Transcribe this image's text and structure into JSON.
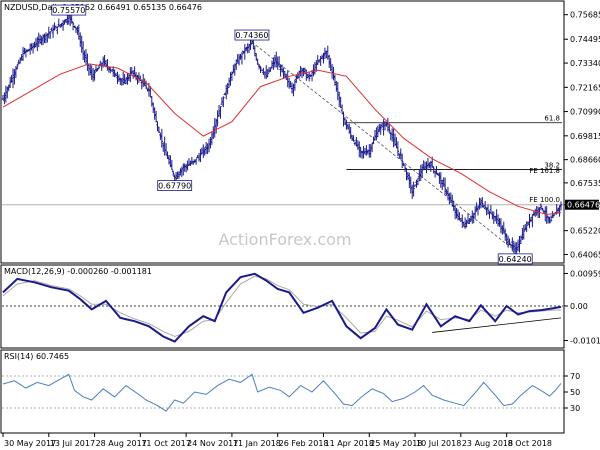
{
  "header": {
    "symbol": "NZDUSD,Daily",
    "ohlc": "0.65162 0.66491 0.65135 0.66476"
  },
  "watermark": "ActionForex.com",
  "chart_data": [
    {
      "type": "candlestick",
      "title": "NZDUSD,Daily 0.65162 0.66491 0.65135 0.66476",
      "ylim": [
        0.637,
        0.763
      ],
      "y_ticks": [
        "0.75685",
        "0.74495",
        "0.73340",
        "0.72165",
        "0.70990",
        "0.69815",
        "0.68660",
        "0.67535",
        "0.66476",
        "0.65220",
        "0.64065"
      ],
      "y_tick_values": [
        0.75685,
        0.74495,
        0.7334,
        0.72165,
        0.7099,
        0.69815,
        0.6866,
        0.67535,
        0.66476,
        0.6522,
        0.64065
      ],
      "last_price": 0.66476,
      "price_keypoints": [
        [
          0,
          0.716
        ],
        [
          6,
          0.726
        ],
        [
          14,
          0.738
        ],
        [
          20,
          0.741
        ],
        [
          28,
          0.746
        ],
        [
          34,
          0.749
        ],
        [
          40,
          0.752
        ],
        [
          46,
          0.7557
        ],
        [
          52,
          0.749
        ],
        [
          56,
          0.738
        ],
        [
          62,
          0.727
        ],
        [
          70,
          0.734
        ],
        [
          78,
          0.728
        ],
        [
          84,
          0.724
        ],
        [
          90,
          0.729
        ],
        [
          96,
          0.725
        ],
        [
          102,
          0.72
        ],
        [
          108,
          0.702
        ],
        [
          114,
          0.689
        ],
        [
          120,
          0.6779
        ],
        [
          126,
          0.683
        ],
        [
          132,
          0.685
        ],
        [
          138,
          0.689
        ],
        [
          144,
          0.694
        ],
        [
          150,
          0.708
        ],
        [
          156,
          0.721
        ],
        [
          162,
          0.732
        ],
        [
          168,
          0.739
        ],
        [
          174,
          0.743
        ],
        [
          178,
          0.733
        ],
        [
          184,
          0.727
        ],
        [
          190,
          0.735
        ],
        [
          196,
          0.728
        ],
        [
          202,
          0.721
        ],
        [
          208,
          0.731
        ],
        [
          214,
          0.726
        ],
        [
          220,
          0.734
        ],
        [
          226,
          0.739
        ],
        [
          232,
          0.724
        ],
        [
          238,
          0.706
        ],
        [
          244,
          0.697
        ],
        [
          250,
          0.69
        ],
        [
          256,
          0.691
        ],
        [
          262,
          0.701
        ],
        [
          268,
          0.704
        ],
        [
          274,
          0.694
        ],
        [
          280,
          0.684
        ],
        [
          286,
          0.671
        ],
        [
          292,
          0.681
        ],
        [
          298,
          0.685
        ],
        [
          304,
          0.679
        ],
        [
          310,
          0.671
        ],
        [
          316,
          0.661
        ],
        [
          322,
          0.655
        ],
        [
          328,
          0.659
        ],
        [
          334,
          0.666
        ],
        [
          340,
          0.661
        ],
        [
          346,
          0.657
        ],
        [
          352,
          0.648
        ],
        [
          358,
          0.6424
        ],
        [
          364,
          0.652
        ],
        [
          370,
          0.66
        ],
        [
          376,
          0.664
        ],
        [
          382,
          0.656
        ],
        [
          386,
          0.661
        ],
        [
          390,
          0.6648
        ]
      ],
      "moving_average": [
        [
          0,
          0.712
        ],
        [
          20,
          0.72
        ],
        [
          40,
          0.728
        ],
        [
          60,
          0.733
        ],
        [
          80,
          0.731
        ],
        [
          100,
          0.724
        ],
        [
          120,
          0.709
        ],
        [
          140,
          0.698
        ],
        [
          160,
          0.705
        ],
        [
          180,
          0.722
        ],
        [
          200,
          0.727
        ],
        [
          220,
          0.73
        ],
        [
          240,
          0.727
        ],
        [
          260,
          0.711
        ],
        [
          280,
          0.697
        ],
        [
          300,
          0.687
        ],
        [
          320,
          0.68
        ],
        [
          340,
          0.671
        ],
        [
          360,
          0.664
        ],
        [
          380,
          0.66
        ],
        [
          390,
          0.661
        ]
      ],
      "annotations": [
        {
          "text": "0.75570",
          "index": 46,
          "price": 0.7557,
          "position": "above"
        },
        {
          "text": "0.74360",
          "index": 174,
          "price": 0.7436,
          "position": "above"
        },
        {
          "text": "0.67790",
          "index": 120,
          "price": 0.6779,
          "position": "below"
        },
        {
          "text": "0.64240",
          "index": 358,
          "price": 0.6424,
          "position": "below"
        }
      ],
      "fibonacci": [
        {
          "label": "61.8",
          "price": 0.7045,
          "from_index": 240
        },
        {
          "label": "38.2",
          "price": 0.6818,
          "from_index": 240
        },
        {
          "label": "FE 161.8",
          "price": 0.6791,
          "from_index": null
        },
        {
          "label": "FE 100.0",
          "price": 0.665,
          "from_index": null
        }
      ],
      "dashed_trendline": [
        [
          174,
          0.7436
        ],
        [
          358,
          0.6424
        ]
      ]
    },
    {
      "type": "line",
      "title": "MACD(12,26,9) -0.000260 -0.001181",
      "ylim": [
        -0.0118,
        0.0115
      ],
      "y_ticks": [
        "0.009597",
        "0.00",
        "-0.01018"
      ],
      "y_tick_values": [
        0.009597,
        0.0,
        -0.01018
      ],
      "series": [
        {
          "name": "MACD",
          "color": "#1a1a8c",
          "points": [
            [
              0,
              0.004
            ],
            [
              10,
              0.008
            ],
            [
              22,
              0.007
            ],
            [
              34,
              0.0055
            ],
            [
              46,
              0.0045
            ],
            [
              54,
              0.002
            ],
            [
              62,
              -0.001
            ],
            [
              72,
              0.0015
            ],
            [
              82,
              -0.0035
            ],
            [
              92,
              -0.0045
            ],
            [
              102,
              -0.006
            ],
            [
              112,
              -0.009
            ],
            [
              120,
              -0.0105
            ],
            [
              130,
              -0.006
            ],
            [
              140,
              -0.003
            ],
            [
              148,
              -0.0045
            ],
            [
              156,
              0.004
            ],
            [
              166,
              0.0085
            ],
            [
              176,
              0.0095
            ],
            [
              184,
              0.0075
            ],
            [
              192,
              0.005
            ],
            [
              200,
              0.004
            ],
            [
              210,
              -0.002
            ],
            [
              220,
              -0.0005
            ],
            [
              230,
              0.0015
            ],
            [
              240,
              -0.006
            ],
            [
              250,
              -0.0095
            ],
            [
              260,
              -0.0065
            ],
            [
              268,
              -0.001
            ],
            [
              276,
              -0.0055
            ],
            [
              286,
              -0.007
            ],
            [
              296,
              0.0005
            ],
            [
              306,
              -0.006
            ],
            [
              316,
              -0.003
            ],
            [
              326,
              -0.0045
            ],
            [
              334,
              0.0002
            ],
            [
              344,
              -0.0045
            ],
            [
              352,
              0.0
            ],
            [
              360,
              -0.0025
            ],
            [
              368,
              -0.0015
            ],
            [
              376,
              -0.0012
            ],
            [
              384,
              -0.0007
            ],
            [
              390,
              -0.00026
            ]
          ]
        },
        {
          "name": "Signal",
          "color": "#aaaaaa",
          "points": [
            [
              0,
              0.003
            ],
            [
              10,
              0.0065
            ],
            [
              22,
              0.0075
            ],
            [
              34,
              0.006
            ],
            [
              46,
              0.005
            ],
            [
              54,
              0.003
            ],
            [
              62,
              0.0005
            ],
            [
              72,
              0.0005
            ],
            [
              82,
              -0.002
            ],
            [
              92,
              -0.0038
            ],
            [
              102,
              -0.0052
            ],
            [
              112,
              -0.0075
            ],
            [
              120,
              -0.009
            ],
            [
              130,
              -0.0075
            ],
            [
              140,
              -0.0045
            ],
            [
              148,
              -0.004
            ],
            [
              156,
              0.001
            ],
            [
              166,
              0.0065
            ],
            [
              176,
              0.0088
            ],
            [
              184,
              0.008
            ],
            [
              192,
              0.006
            ],
            [
              200,
              0.0048
            ],
            [
              210,
              0.0005
            ],
            [
              220,
              -0.0002
            ],
            [
              230,
              0.0005
            ],
            [
              240,
              -0.0035
            ],
            [
              250,
              -0.008
            ],
            [
              260,
              -0.0075
            ],
            [
              268,
              -0.003
            ],
            [
              276,
              -0.0042
            ],
            [
              286,
              -0.0062
            ],
            [
              296,
              -0.0015
            ],
            [
              306,
              -0.004
            ],
            [
              316,
              -0.0035
            ],
            [
              326,
              -0.004
            ],
            [
              334,
              -0.0012
            ],
            [
              344,
              -0.003
            ],
            [
              352,
              -0.0012
            ],
            [
              360,
              -0.002
            ],
            [
              368,
              -0.0018
            ],
            [
              376,
              -0.0015
            ],
            [
              384,
              -0.0012
            ],
            [
              390,
              -0.00118
            ]
          ]
        }
      ],
      "trendline": [
        [
          300,
          -0.0078
        ],
        [
          390,
          -0.0035
        ]
      ]
    },
    {
      "type": "line",
      "title": "RSI(14) 60.7465",
      "ylim": [
        0,
        100
      ],
      "y_ticks": [
        "70",
        "50",
        "30"
      ],
      "y_tick_values": [
        70,
        50,
        30
      ],
      "series": [
        {
          "name": "RSI",
          "color": "#4a7fc1",
          "points": [
            [
              0,
              60
            ],
            [
              8,
              64
            ],
            [
              16,
              55
            ],
            [
              24,
              62
            ],
            [
              32,
              58
            ],
            [
              40,
              66
            ],
            [
              46,
              72
            ],
            [
              50,
              52
            ],
            [
              56,
              44
            ],
            [
              62,
              40
            ],
            [
              70,
              54
            ],
            [
              78,
              44
            ],
            [
              86,
              58
            ],
            [
              94,
              48
            ],
            [
              100,
              40
            ],
            [
              108,
              33
            ],
            [
              114,
              26
            ],
            [
              120,
              40
            ],
            [
              126,
              36
            ],
            [
              134,
              50
            ],
            [
              142,
              47
            ],
            [
              150,
              58
            ],
            [
              158,
              66
            ],
            [
              166,
              62
            ],
            [
              174,
              72
            ],
            [
              178,
              50
            ],
            [
              186,
              56
            ],
            [
              194,
              52
            ],
            [
              200,
              44
            ],
            [
              208,
              58
            ],
            [
              216,
              50
            ],
            [
              224,
              64
            ],
            [
              232,
              48
            ],
            [
              238,
              35
            ],
            [
              244,
              33
            ],
            [
              250,
              43
            ],
            [
              258,
              54
            ],
            [
              266,
              48
            ],
            [
              272,
              38
            ],
            [
              280,
              42
            ],
            [
              288,
              50
            ],
            [
              294,
              58
            ],
            [
              300,
              46
            ],
            [
              308,
              40
            ],
            [
              316,
              36
            ],
            [
              322,
              33
            ],
            [
              330,
              49
            ],
            [
              336,
              62
            ],
            [
              344,
              46
            ],
            [
              350,
              33
            ],
            [
              356,
              35
            ],
            [
              362,
              46
            ],
            [
              370,
              58
            ],
            [
              376,
              52
            ],
            [
              382,
              45
            ],
            [
              386,
              52
            ],
            [
              390,
              60.7
            ]
          ]
        }
      ]
    }
  ],
  "x_axis": {
    "count": 391,
    "labels": [
      {
        "index": 0,
        "text": "30 May 2017"
      },
      {
        "index": 32,
        "text": "13 Jul 2017"
      },
      {
        "index": 64,
        "text": "28 Aug 2017"
      },
      {
        "index": 96,
        "text": "11 Oct 2017"
      },
      {
        "index": 128,
        "text": "24 Nov 2017"
      },
      {
        "index": 160,
        "text": "11 Jan 2018"
      },
      {
        "index": 192,
        "text": "26 Feb 2018"
      },
      {
        "index": 224,
        "text": "11 Apr 2018"
      },
      {
        "index": 256,
        "text": "25 May 2018"
      },
      {
        "index": 288,
        "text": "10 Jul 2018"
      },
      {
        "index": 320,
        "text": "23 Aug 2018"
      },
      {
        "index": 352,
        "text": "8 Oct 2018"
      }
    ]
  },
  "colors": {
    "price": "#1a1a8c",
    "ma": "#e03030",
    "grid": "#999999",
    "watermark": "#c8c8c8",
    "macd": "#1a1a8c",
    "signal": "#aaaaaa",
    "rsi": "#4a7fc1"
  }
}
